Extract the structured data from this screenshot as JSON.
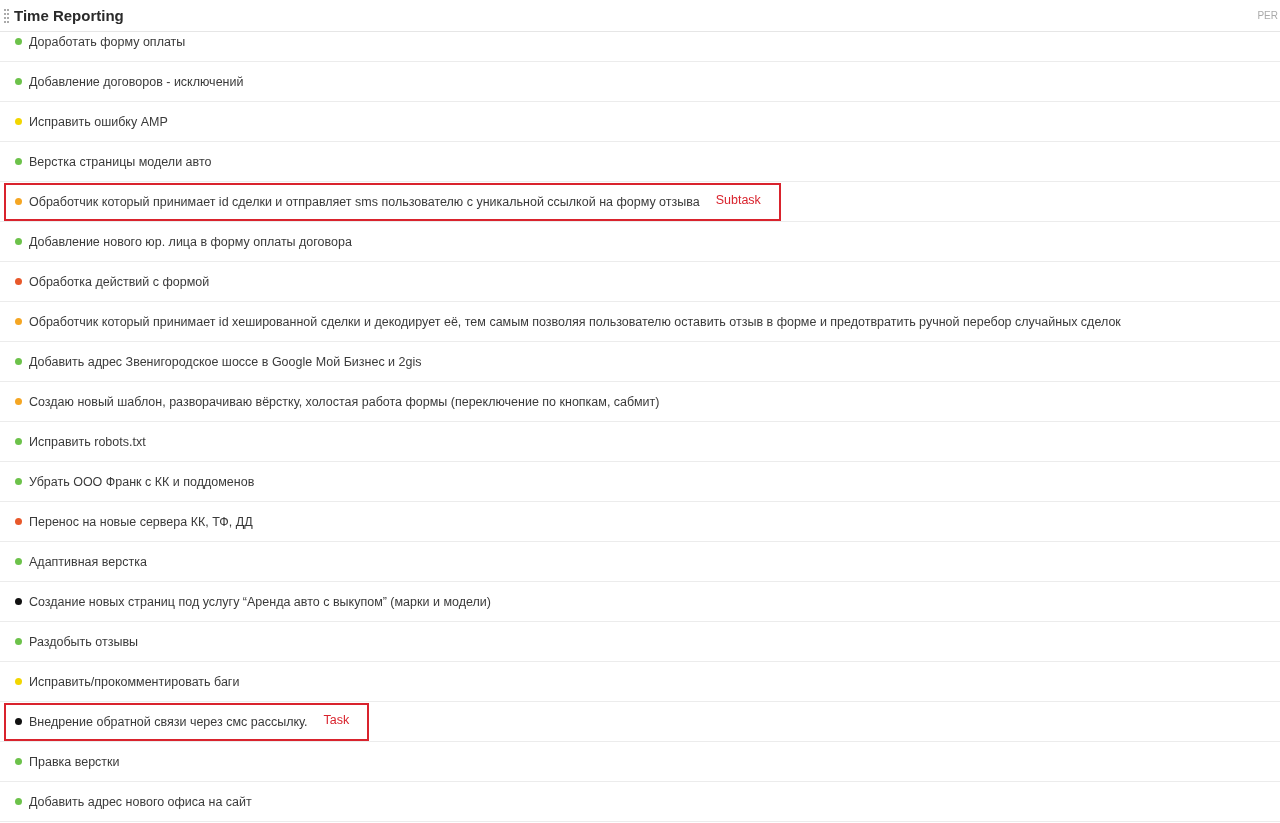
{
  "header": {
    "title": "Time Reporting",
    "right_label": "PER"
  },
  "tasks": [
    {
      "name": "Доработать форму оплаты",
      "color": "#6cc24a"
    },
    {
      "name": "Добавление договоров - исключений",
      "color": "#6cc24a"
    },
    {
      "name": "Исправить ошибку AMP",
      "color": "#f2d600"
    },
    {
      "name": "Верстка страницы модели авто",
      "color": "#6cc24a"
    },
    {
      "name": "Обработчик который принимает id сделки и отправляет sms пользователю с уникальной ссылкой на форму отзыва",
      "color": "#f5a623",
      "annotation": "Subtask"
    },
    {
      "name": "Добавление нового юр. лица в форму оплаты договора",
      "color": "#6cc24a"
    },
    {
      "name": "Обработка действий с формой",
      "color": "#e8582a"
    },
    {
      "name": "Обработчик который принимает id хешированной сделки и декодирует её, тем самым позволяя пользователю оставить отзыв в форме и предотвратить ручной перебор случайных сделок",
      "color": "#f5a623"
    },
    {
      "name": "Добавить адрес Звенигородское шоссе в Google Мой Бизнес и 2gis",
      "color": "#6cc24a"
    },
    {
      "name": "Создаю новый шаблон, разворачиваю вёрстку, холостая работа формы (переключение по кнопкам, сабмит)",
      "color": "#f5a623"
    },
    {
      "name": "Исправить robots.txt",
      "color": "#6cc24a"
    },
    {
      "name": "Убрать ООО Франк с КК и поддоменов",
      "color": "#6cc24a"
    },
    {
      "name": "Перенос на новые сервера КК, ТФ, ДД",
      "color": "#e8582a"
    },
    {
      "name": "Адаптивная верстка",
      "color": "#6cc24a"
    },
    {
      "name": "Создание новых страниц под услугу “Аренда авто с выкупом” (марки и модели)",
      "color": "#111111"
    },
    {
      "name": "Раздобыть отзывы",
      "color": "#6cc24a"
    },
    {
      "name": "Исправить/прокомментировать баги",
      "color": "#f2d600"
    },
    {
      "name": "Внедрение обратной связи через смс рассылку.",
      "color": "#111111",
      "annotation": "Task"
    },
    {
      "name": "Правка верстки",
      "color": "#6cc24a"
    },
    {
      "name": "Добавить адрес нового офиса на сайт",
      "color": "#6cc24a"
    }
  ]
}
